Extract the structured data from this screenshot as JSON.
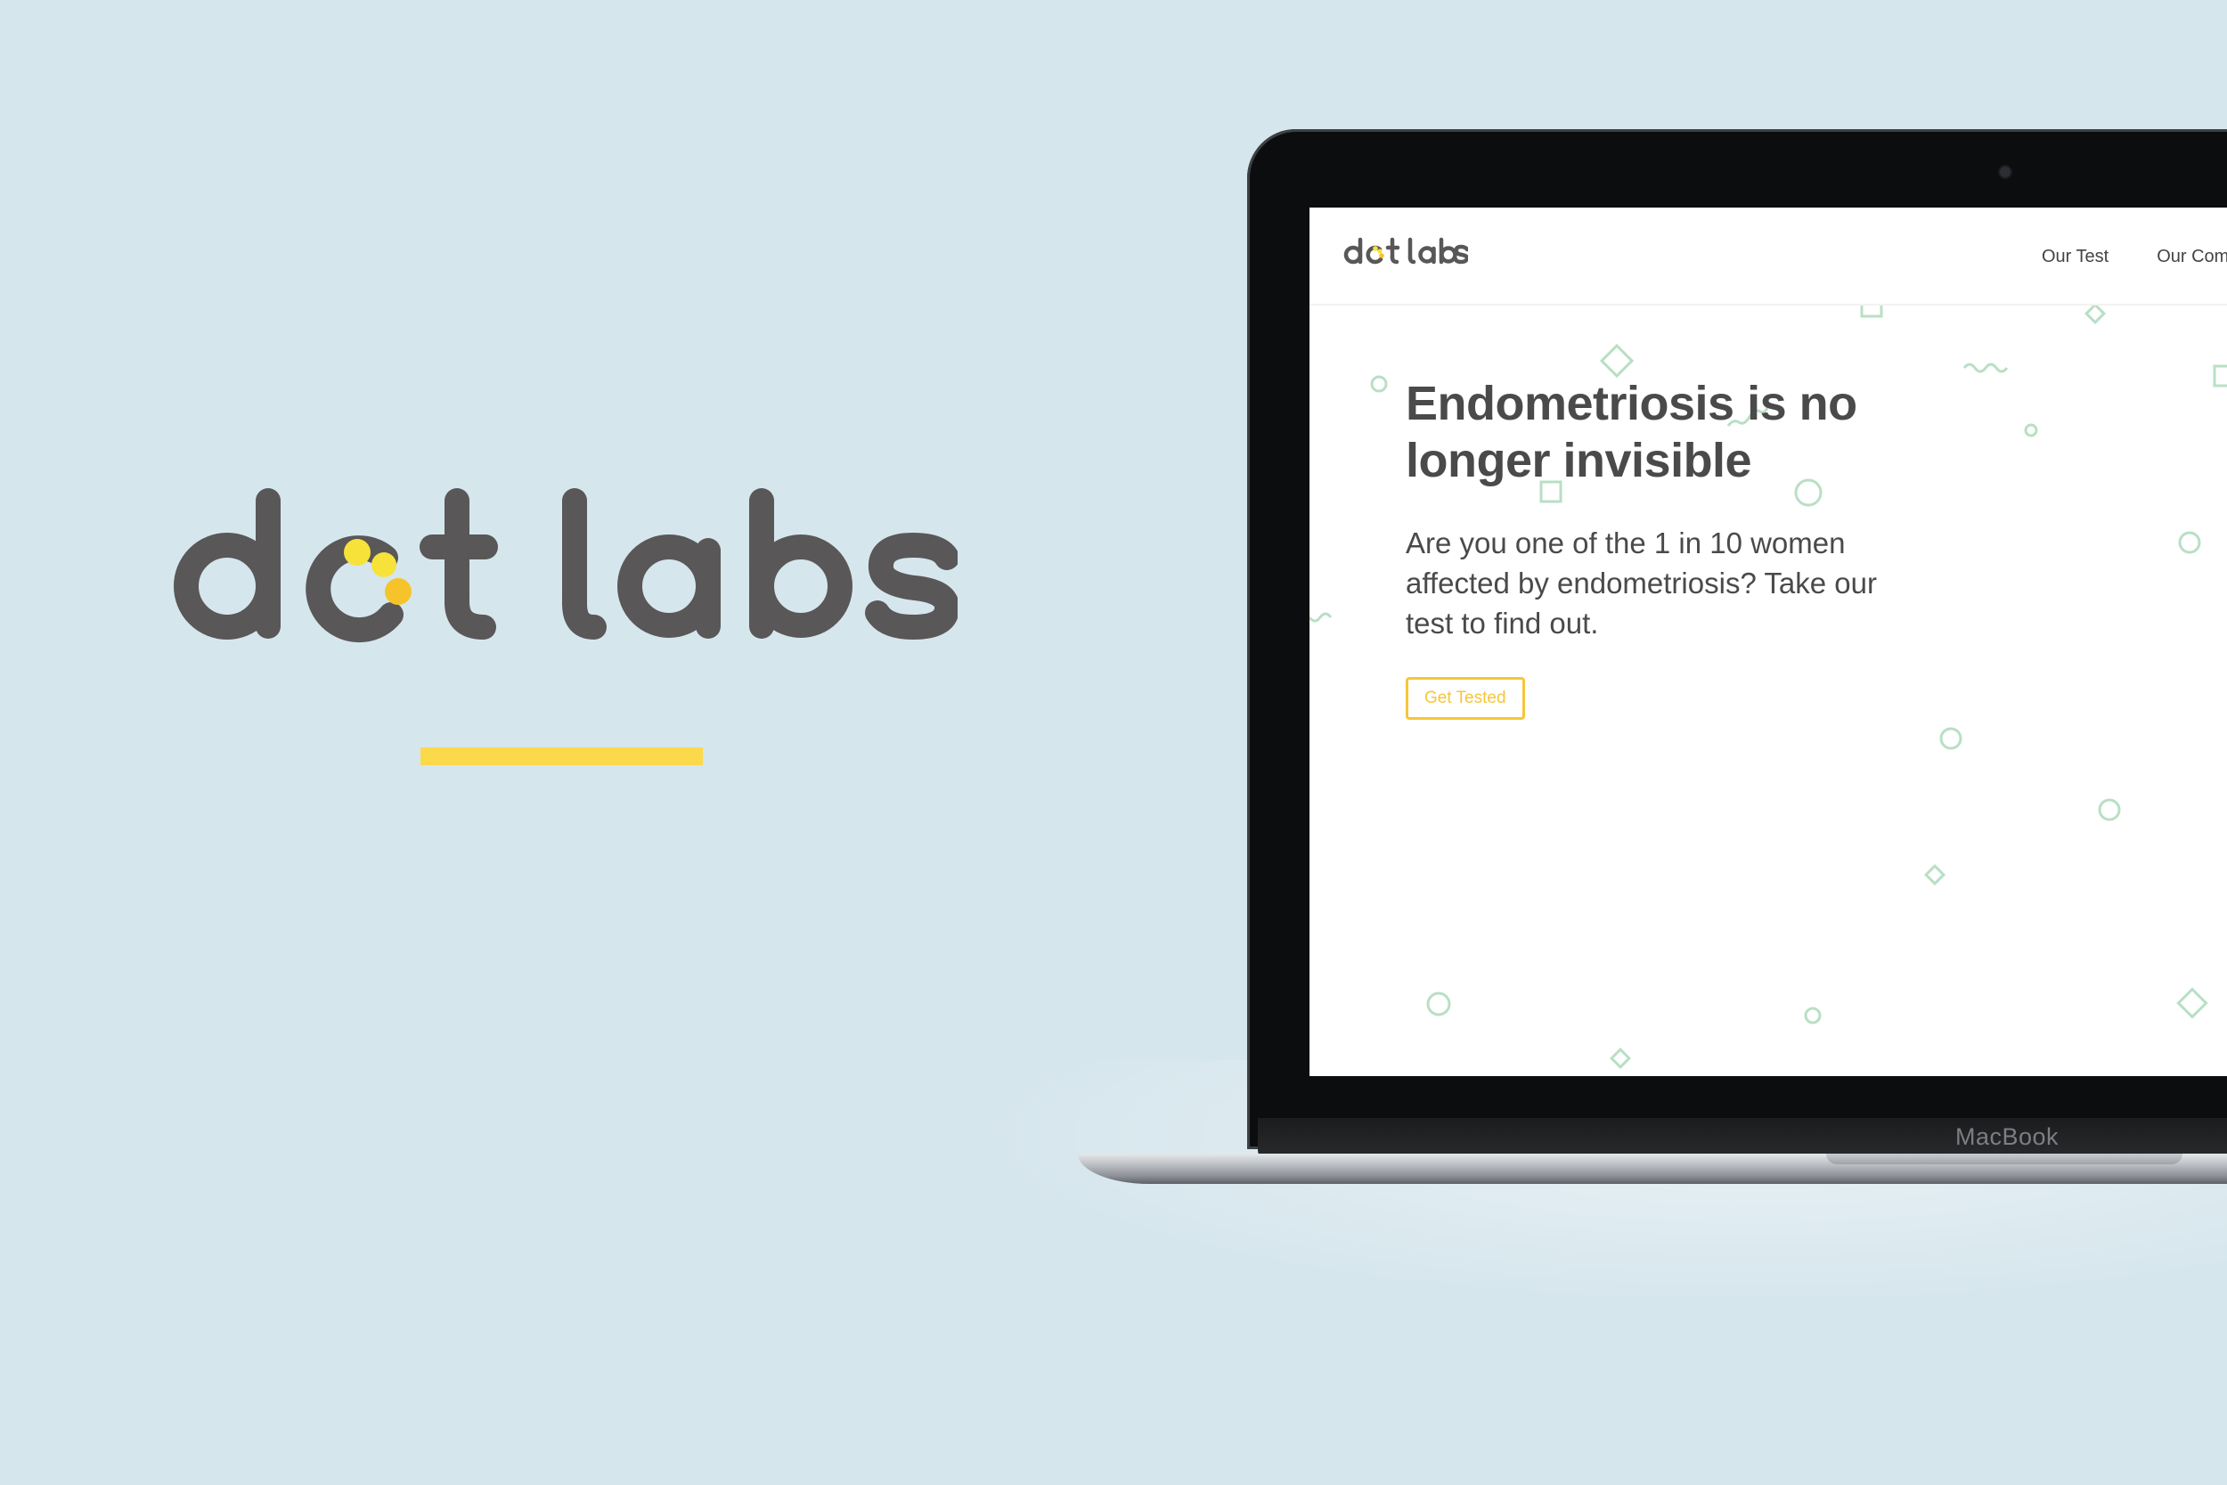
{
  "brand": {
    "logo_text": "dot labs",
    "colors": {
      "dark": "#595758",
      "dot_yellow": "#f7e23a",
      "dot_amber": "#f6c42a",
      "accent": "#f5c63a",
      "shape_green": "#b8dfc5",
      "background": "#d6e6ed"
    }
  },
  "laptop": {
    "brand_label": "MacBook"
  },
  "site": {
    "logo_text": "dot labs",
    "nav": {
      "items": [
        "Our Test",
        "Our Com"
      ]
    },
    "hero": {
      "title": "Endometriosis is no longer invisible",
      "body": "Are you one of the 1 in 10 women affected by endometriosis? Take our test to find out.",
      "cta_label": "Get Tested"
    }
  }
}
